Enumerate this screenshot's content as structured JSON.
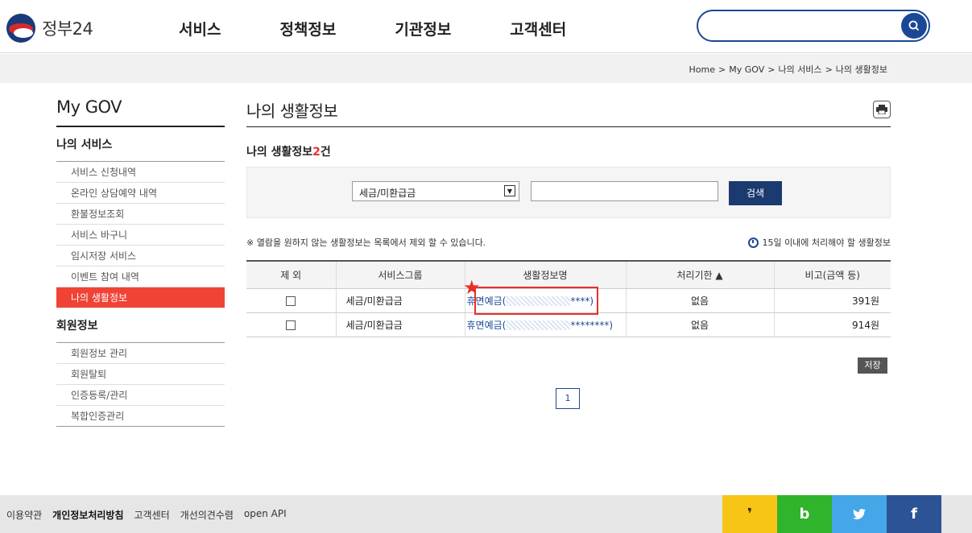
{
  "header": {
    "logo_text": "정부24",
    "nav": [
      "서비스",
      "정책정보",
      "기관정보",
      "고객센터"
    ],
    "search_placeholder": ""
  },
  "breadcrumb": [
    "Home",
    "My GOV",
    "나의 서비스",
    "나의 생활정보"
  ],
  "sidebar": {
    "title": "My GOV",
    "sections": [
      {
        "label": "나의 서비스",
        "items": [
          "서비스 신청내역",
          "온라인 상담예약 내역",
          "환불정보조회",
          "서비스 바구니",
          "임시저장 서비스",
          "이벤트 참여 내역",
          "나의 생활정보"
        ]
      },
      {
        "label": "회원정보",
        "items": [
          "회원정보 관리",
          "회원탈퇴",
          "인증등록/관리",
          "복합인증관리"
        ]
      }
    ],
    "active_item": "나의 생활정보"
  },
  "main": {
    "title": "나의 생활정보",
    "count_prefix": "나의 생활정보",
    "count_num": "2",
    "count_suffix": "건",
    "filter": {
      "selected": "세금/미환급금",
      "input_value": "",
      "search_label": "검색"
    },
    "note_left": "※ 열람을 원하지 않는 생활정보는 목록에서 제외 할 수 있습니다.",
    "note_right": "15일 이내에 처리해야 할 생활정보",
    "table": {
      "headers": [
        "제 외",
        "서비스그룹",
        "생활정보명",
        "처리기한 ▲",
        "비고(금액 등)"
      ],
      "rows": [
        {
          "group": "세금/미환급금",
          "name_prefix": "휴면예금(",
          "name_suffix": "****)",
          "due": "없음",
          "note": "391원"
        },
        {
          "group": "세금/미환급금",
          "name_prefix": "휴면예금(",
          "name_suffix": "********)",
          "due": "없음",
          "note": "914원"
        }
      ]
    },
    "save_label": "저장",
    "page": "1"
  },
  "footer": {
    "links": [
      "이용약관",
      "개인정보처리방침",
      "고객센터",
      "개선의견수렴",
      "open API"
    ],
    "social": [
      "kakao",
      "band",
      "twitter",
      "facebook"
    ]
  },
  "colors": {
    "brand_blue": "#1b4896",
    "accent_red": "#f04336"
  }
}
